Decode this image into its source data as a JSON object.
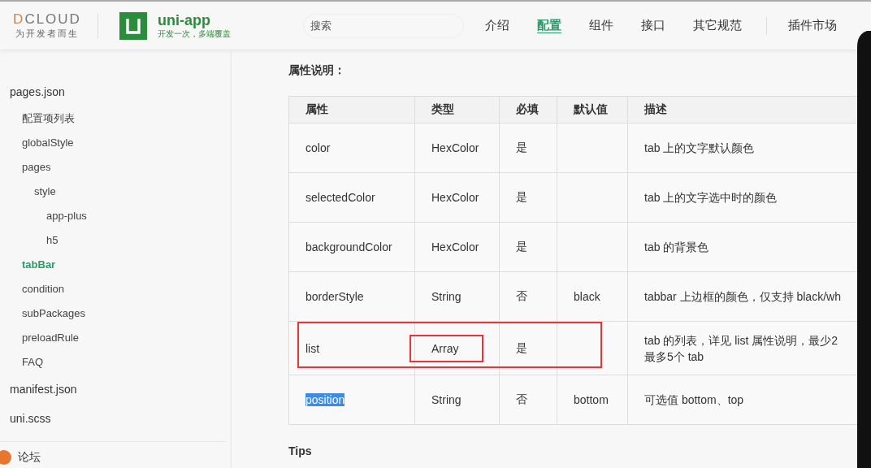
{
  "header": {
    "logo": {
      "text": "DCLOUD",
      "tagline": "为开发者而生"
    },
    "brand": {
      "name": "uni-app",
      "slogan": "开发一次，多端覆盖"
    },
    "search": {
      "placeholder": "搜索"
    },
    "nav": [
      {
        "label": "介绍",
        "selected": false
      },
      {
        "label": "配置",
        "selected": true
      },
      {
        "label": "组件",
        "selected": false
      },
      {
        "label": "接口",
        "selected": false
      },
      {
        "label": "其它规范",
        "selected": false
      }
    ],
    "nav_extra": "插件市场"
  },
  "sidebar": {
    "items": [
      {
        "label": "pages.json",
        "selected": false,
        "children": [
          {
            "label": "配置项列表",
            "selected": false
          },
          {
            "label": "globalStyle",
            "selected": false
          },
          {
            "label": "pages",
            "selected": false,
            "children": [
              {
                "label": "style",
                "selected": false,
                "children": [
                  {
                    "label": "app-plus",
                    "selected": false
                  },
                  {
                    "label": "h5",
                    "selected": false
                  }
                ]
              }
            ]
          },
          {
            "label": "tabBar",
            "selected": true
          },
          {
            "label": "condition",
            "selected": false
          },
          {
            "label": "subPackages",
            "selected": false
          },
          {
            "label": "preloadRule",
            "selected": false
          },
          {
            "label": "FAQ",
            "selected": false
          }
        ]
      },
      {
        "label": "manifest.json",
        "selected": false
      },
      {
        "label": "uni.scss",
        "selected": false
      }
    ],
    "footer_link": "论坛"
  },
  "content": {
    "heading": "属性说明：",
    "table": {
      "columns": [
        "属性",
        "类型",
        "必填",
        "默认值",
        "描述"
      ],
      "rows": [
        {
          "name": "color",
          "type": "HexColor",
          "required": "是",
          "default": "",
          "description": [
            "tab 上的文字默认颜色"
          ],
          "text_selected": false,
          "row_boxed": false,
          "type_boxed": false
        },
        {
          "name": "selectedColor",
          "type": "HexColor",
          "required": "是",
          "default": "",
          "description": [
            "tab 上的文字选中时的颜色"
          ],
          "text_selected": false,
          "row_boxed": false,
          "type_boxed": false
        },
        {
          "name": "backgroundColor",
          "type": "HexColor",
          "required": "是",
          "default": "",
          "description": [
            "tab 的背景色"
          ],
          "text_selected": false,
          "row_boxed": false,
          "type_boxed": false
        },
        {
          "name": "borderStyle",
          "type": "String",
          "required": "否",
          "default": "black",
          "description": [
            "tabbar 上边框的颜色，仅支持 black/wh"
          ],
          "text_selected": false,
          "row_boxed": false,
          "type_boxed": false
        },
        {
          "name": "list",
          "type": "Array",
          "required": "是",
          "default": "",
          "description": [
            "tab 的列表，详见 list 属性说明，最少2",
            "最多5个 tab"
          ],
          "text_selected": false,
          "row_boxed": true,
          "type_boxed": true
        },
        {
          "name": "position",
          "type": "String",
          "required": "否",
          "default": "bottom",
          "description": [
            "可选值 bottom、top"
          ],
          "text_selected": true,
          "row_boxed": false,
          "type_boxed": false
        }
      ]
    },
    "tips_heading": "Tips"
  }
}
